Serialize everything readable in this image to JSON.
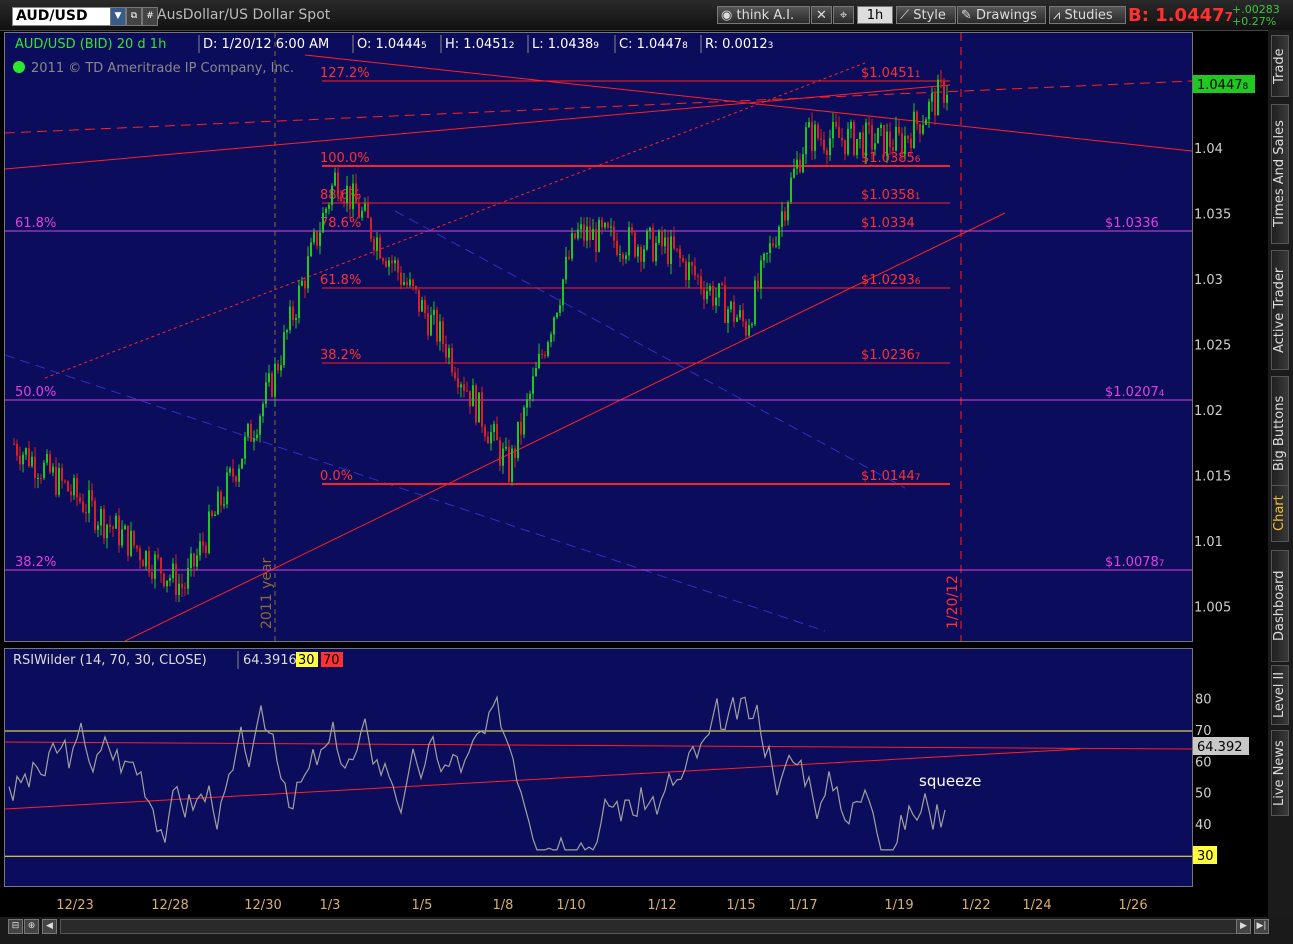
{
  "window": {
    "symbol": "AUD/USD",
    "description": "AusDollar/US Dollar Spot",
    "buttons": [
      "think A.I.",
      "1h",
      "Style",
      "Drawings",
      "Studies"
    ],
    "last_label": "B: 1.0447",
    "last_sub": "7",
    "change": "+.00283",
    "change_pct": "+0.27%"
  },
  "chart": {
    "header": [
      "AUD/USD (BID) 20 d 1h",
      "D: 1/20/12 6:00 AM",
      "O: 1.0444",
      "H: 1.0451",
      "L: 1.0438",
      "C: 1.0447",
      "R: 0.0012"
    ],
    "header_subs": [
      "",
      "",
      "5",
      "2",
      "9",
      "8",
      "3"
    ],
    "copyright": "2011 © TD Ameritrade IP Company, Inc.",
    "year_marker": "2011 year",
    "date_marker": "1/20/12",
    "annotation": "squeeze",
    "price_axis": [
      "1.04",
      "1.035",
      "1.03",
      "1.025",
      "1.02",
      "1.015",
      "1.01",
      "1.005"
    ],
    "current_price": "1.0447",
    "current_price_sub": "8",
    "fib_red": [
      {
        "pct": "127.2%",
        "price": "$1.0451",
        "sub": "1"
      },
      {
        "pct": "100.0%",
        "price": "$1.0385",
        "sub": "6"
      },
      {
        "pct": "88.6%",
        "price": "$1.0358",
        "sub": "1"
      },
      {
        "pct": "78.6%",
        "price": "$1.0334",
        "sub": ""
      },
      {
        "pct": "61.8%",
        "price": "$1.0293",
        "sub": "6"
      },
      {
        "pct": "38.2%",
        "price": "$1.0236",
        "sub": "7"
      },
      {
        "pct": "0.0%",
        "price": "$1.0144",
        "sub": "7"
      }
    ],
    "fib_magenta": [
      {
        "pct": "61.8%",
        "price": "$1.0336",
        "sub": ""
      },
      {
        "pct": "50.0%",
        "price": "$1.0207",
        "sub": "4"
      },
      {
        "pct": "38.2%",
        "price": "$1.0078",
        "sub": "7"
      }
    ]
  },
  "rsi": {
    "header": "RSIWilder (14, 70, 30, CLOSE)",
    "value": "64.3916",
    "levels": [
      "30",
      "70"
    ],
    "axis": [
      "80",
      "70",
      "60",
      "50",
      "40"
    ],
    "current": "64.392",
    "oversold": "30"
  },
  "time_axis": [
    "12/23",
    "12/28",
    "12/30",
    "1/3",
    "1/5",
    "1/8",
    "1/10",
    "1/12",
    "1/15",
    "1/17",
    "1/19",
    "1/22",
    "1/24",
    "1/26"
  ],
  "side_tabs": [
    "Trade",
    "Times And Sales",
    "Active Trader",
    "Big Buttons",
    "Chart",
    "Dashboard",
    "Level II",
    "Live News"
  ],
  "colors": {
    "background": "#0c0c5c",
    "bull": "#1ec81e",
    "bear": "#d82020",
    "fib": "#ff2020",
    "magenta": "#e040e0",
    "rsi": "#a0a0a0"
  },
  "chart_data": {
    "type": "candlestick",
    "x": [
      "12/23",
      "12/28",
      "12/30",
      "1/3",
      "1/5",
      "1/8",
      "1/10",
      "1/12",
      "1/15",
      "1/17",
      "1/19",
      "1/20"
    ],
    "close": [
      1.0175,
      1.0065,
      1.022,
      1.038,
      1.025,
      1.0155,
      1.0335,
      1.0325,
      1.0265,
      1.041,
      1.0405,
      1.0448
    ]
  }
}
